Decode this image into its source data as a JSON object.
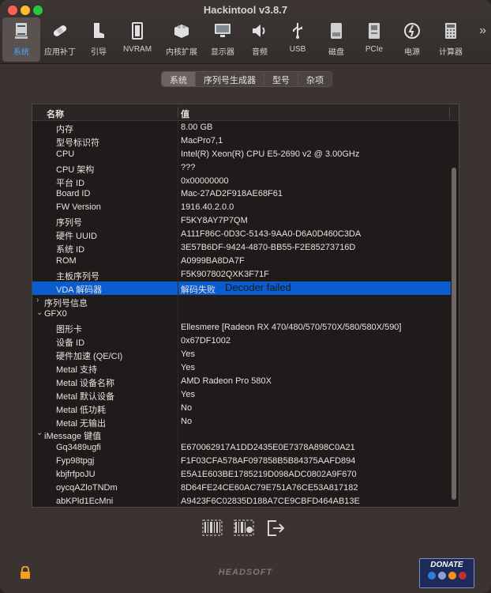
{
  "window": {
    "title": "Hackintool v3.8.7"
  },
  "toolbar": {
    "items": [
      {
        "label": "系统",
        "icon": "computer-icon"
      },
      {
        "label": "应用补丁",
        "icon": "bandage-icon"
      },
      {
        "label": "引导",
        "icon": "boot-icon"
      },
      {
        "label": "NVRAM",
        "icon": "nvram-chip-icon"
      },
      {
        "label": "内核扩展",
        "icon": "lego-brick-icon"
      },
      {
        "label": "显示器",
        "icon": "monitor-icon"
      },
      {
        "label": "音频",
        "icon": "speaker-icon"
      },
      {
        "label": "USB",
        "icon": "usb-icon"
      },
      {
        "label": "磁盘",
        "icon": "disk-icon"
      },
      {
        "label": "PCIe",
        "icon": "pcie-card-icon"
      },
      {
        "label": "电源",
        "icon": "power-icon"
      },
      {
        "label": "计算器",
        "icon": "calculator-icon"
      }
    ],
    "more": "»"
  },
  "tabs": [
    "系统",
    "序列号生成器",
    "型号",
    "杂项"
  ],
  "table": {
    "headers": {
      "name": "名称",
      "value": "值"
    },
    "rows": [
      {
        "k": "内存",
        "v": "8.00 GB",
        "indent": 2
      },
      {
        "k": "型号标识符",
        "v": "MacPro7,1",
        "indent": 2
      },
      {
        "k": "CPU",
        "v": "Intel(R) Xeon(R) CPU E5-2690 v2 @ 3.00GHz",
        "indent": 2
      },
      {
        "k": "CPU 架构",
        "v": "???",
        "indent": 2
      },
      {
        "k": "平台 ID",
        "v": "0x00000000",
        "indent": 2
      },
      {
        "k": "Board ID",
        "v": "Mac-27AD2F918AE68F61",
        "indent": 2
      },
      {
        "k": "FW Version",
        "v": "1916.40.2.0.0",
        "indent": 2
      },
      {
        "k": "序列号",
        "v": "F5KY8AY7P7QM",
        "indent": 2
      },
      {
        "k": "硬件 UUID",
        "v": "A111F86C-0D3C-5143-9AA0-D6A0D460C3DA",
        "indent": 2
      },
      {
        "k": "系统 ID",
        "v": "3E57B6DF-9424-4870-BB55-F2E85273716D",
        "indent": 2
      },
      {
        "k": "ROM",
        "v": "A0999BA8DA7F",
        "indent": 2
      },
      {
        "k": "主板序列号",
        "v": "F5K907802QXK3F71F",
        "indent": 2
      },
      {
        "k": "VDA 解码器",
        "v": "解码失败",
        "indent": 2,
        "selected": true,
        "tooltip": "Decoder failed"
      },
      {
        "k": "序列号信息",
        "v": "",
        "indent": 1,
        "arrow": "›"
      },
      {
        "k": "GFX0",
        "v": "",
        "indent": 1,
        "arrow": "⌄"
      },
      {
        "k": "图形卡",
        "v": "Ellesmere [Radeon RX 470/480/570/570X/580/580X/590]",
        "indent": 2
      },
      {
        "k": "设备 ID",
        "v": "0x67DF1002",
        "indent": 2
      },
      {
        "k": "硬件加速 (QE/CI)",
        "v": "Yes",
        "indent": 2
      },
      {
        "k": "Metal 支持",
        "v": "Yes",
        "indent": 2
      },
      {
        "k": "Metal 设备名称",
        "v": "AMD Radeon Pro 580X",
        "indent": 2
      },
      {
        "k": "Metal 默认设备",
        "v": "Yes",
        "indent": 2
      },
      {
        "k": "Metal 低功耗",
        "v": "No",
        "indent": 2
      },
      {
        "k": "Metal 无输出",
        "v": "No",
        "indent": 2
      },
      {
        "k": "iMessage 键值",
        "v": "",
        "indent": 1,
        "arrow": "⌄"
      },
      {
        "k": "Gq3489ugfi",
        "v": "E670062917A1DD2435E0E7378A898C0A21",
        "indent": 2
      },
      {
        "k": "Fyp98tpgj",
        "v": "F1F03CFA578AF097858B5B84375AAFD894",
        "indent": 2
      },
      {
        "k": "kbjfrfpoJU",
        "v": "E5A1E603BE1785219D098ADC0802A9F670",
        "indent": 2
      },
      {
        "k": "oycqAZloTNDm",
        "v": "8D64FE24CE60AC79E751A76CE53A817182",
        "indent": 2
      },
      {
        "k": "abKPld1EcMni",
        "v": "A9423F6C02835D188A7CE9CBFD464AB13E",
        "indent": 2
      }
    ]
  },
  "bottom": {
    "icons": [
      "barcode-icon",
      "barcode-apple-icon",
      "export-icon"
    ],
    "brand": "HEADSOFT",
    "donate": "DONATE"
  },
  "colors": {
    "selection": "#0a5ccf",
    "accent": "#4ea3ff"
  }
}
